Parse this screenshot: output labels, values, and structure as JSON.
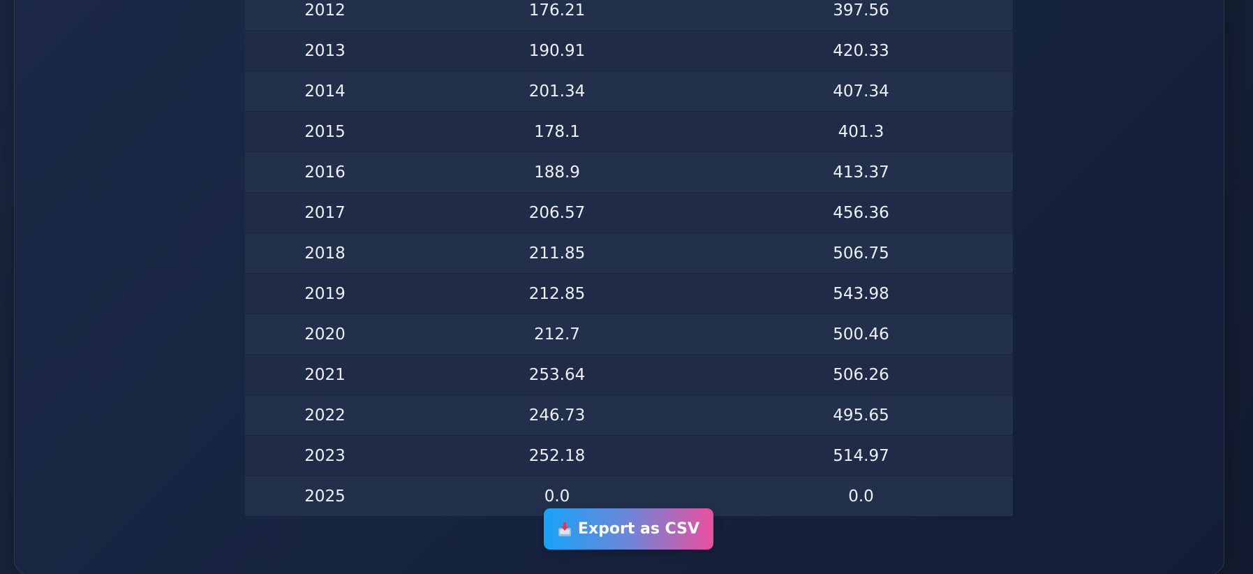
{
  "table": {
    "rows": [
      [
        "2012",
        "176.21",
        "397.56"
      ],
      [
        "2013",
        "190.91",
        "420.33"
      ],
      [
        "2014",
        "201.34",
        "407.34"
      ],
      [
        "2015",
        "178.1",
        "401.3"
      ],
      [
        "2016",
        "188.9",
        "413.37"
      ],
      [
        "2017",
        "206.57",
        "456.36"
      ],
      [
        "2018",
        "211.85",
        "506.75"
      ],
      [
        "2019",
        "212.85",
        "543.98"
      ],
      [
        "2020",
        "212.7",
        "500.46"
      ],
      [
        "2021",
        "253.64",
        "506.26"
      ],
      [
        "2022",
        "246.73",
        "495.65"
      ],
      [
        "2023",
        "252.18",
        "514.97"
      ],
      [
        "2025",
        "0.0",
        "0.0"
      ]
    ]
  },
  "export_button": {
    "label": "Export as CSV",
    "icon": "inbox-tray-icon"
  }
}
